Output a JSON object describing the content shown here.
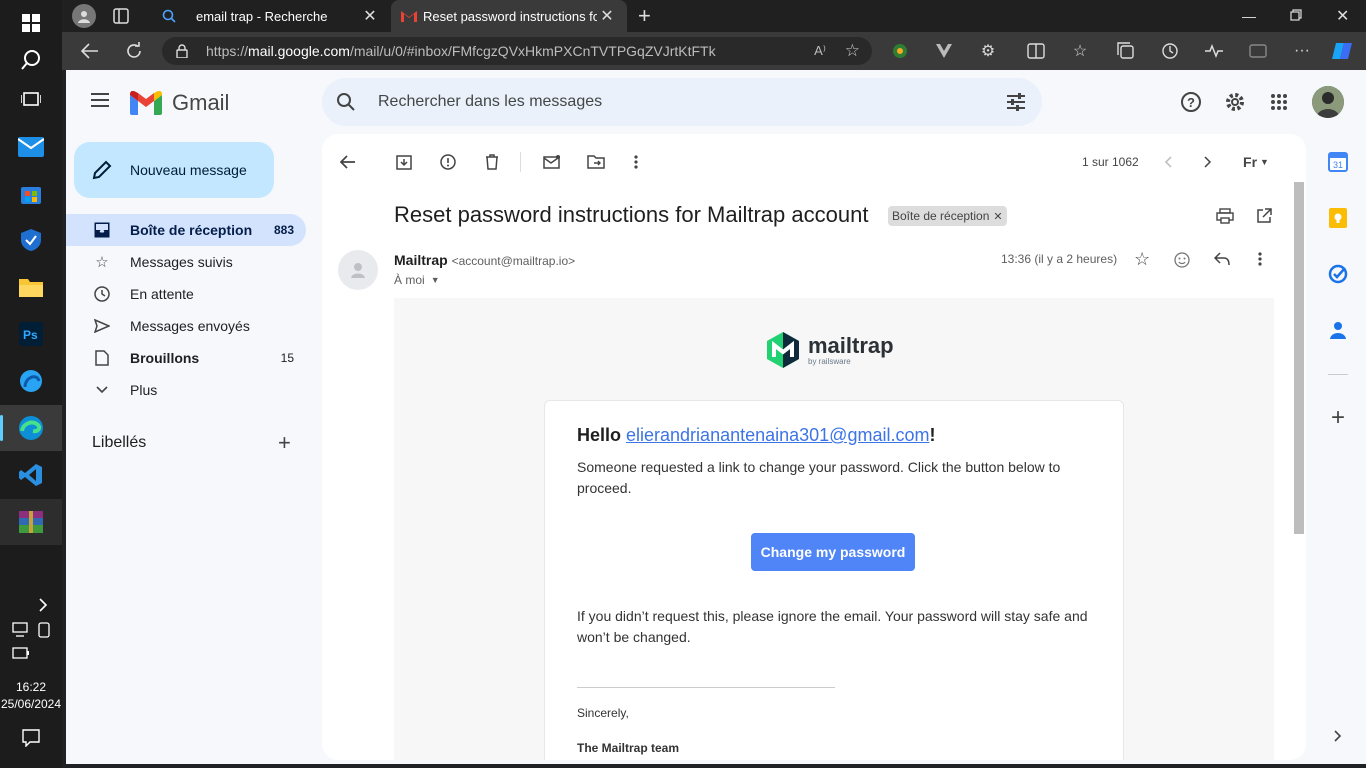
{
  "taskbar": {
    "clock_time": "16:22",
    "clock_date": "25/06/2024"
  },
  "browser": {
    "tabs": [
      {
        "title": "email trap - Recherche"
      },
      {
        "title": "Reset password instructions for M"
      }
    ],
    "url_prefix": "https://",
    "url_host": "mail.google.com",
    "url_path": "/mail/u/0/#inbox/FMfcgzQVxHkmPXCnTVTPGqZVJrtKtFTk"
  },
  "gmail": {
    "brand": "Gmail",
    "search_placeholder": "Rechercher dans les messages",
    "compose_label": "Nouveau message",
    "nav": [
      {
        "label": "Boîte de réception",
        "count": "883"
      },
      {
        "label": "Messages suivis",
        "count": ""
      },
      {
        "label": "En attente",
        "count": ""
      },
      {
        "label": "Messages envoyés",
        "count": ""
      },
      {
        "label": "Brouillons",
        "count": "15"
      },
      {
        "label": "Plus",
        "count": ""
      }
    ],
    "labels_heading": "Libellés",
    "pagination": "1 sur 1062"
  },
  "message": {
    "subject": "Reset password instructions for Mailtrap account",
    "label_chip": "Boîte de réception",
    "sender_name": "Mailtrap",
    "sender_email": "<account@mailtrap.io>",
    "recipient": "À moi",
    "time": "13:36 (il y a 2 heures)",
    "logo_name": "mailtrap",
    "logo_sub": "by railsware",
    "greeting": "Hello ",
    "greeting_email": "elierandrianantenaina301@gmail.com",
    "greeting_end": "!",
    "para1": "Someone requested a link to change your password. Click the button below to proceed.",
    "button_label": "Change my password",
    "para2": "If you didn’t request this, please ignore the email. Your password will stay safe and won’t be changed.",
    "signoff": "Sincerely,",
    "team": "The Mailtrap team"
  }
}
